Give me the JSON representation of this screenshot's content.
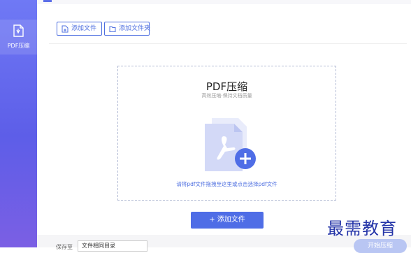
{
  "sidebar": {
    "items": [
      {
        "label": "PDF压缩",
        "icon": "pdf-compress-icon"
      }
    ]
  },
  "toolbar": {
    "add_file": "添加文件",
    "add_folder": "添加文件夹"
  },
  "dropzone": {
    "title": "PDF压缩",
    "subtitle": "高效压缩·保持文档质量",
    "hint": "请将pdf文件拖拽至这里或点击选择pdf文件"
  },
  "add_button": {
    "label": "+ 添加文件"
  },
  "footer": {
    "save_label": "保存至",
    "save_value": "文件相同目录",
    "start_label": "开始压缩"
  },
  "watermark": "最需教育",
  "colors": {
    "accent": "#4f6de6",
    "sidebar_top": "#6f79f5",
    "sidebar_bottom": "#7b5fe4"
  }
}
